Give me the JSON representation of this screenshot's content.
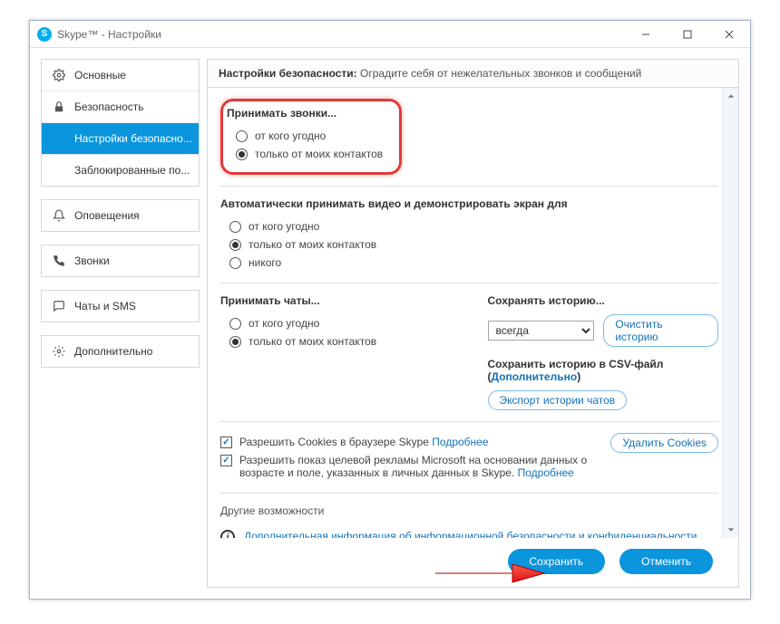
{
  "window": {
    "title": "Skype™ - Настройки"
  },
  "sidebar": {
    "general": "Основные",
    "security": "Безопасность",
    "security_settings": "Настройки безопасно...",
    "blocked": "Заблокированные по...",
    "notifications": "Оповещения",
    "calls": "Звонки",
    "chats_sms": "Чаты и SMS",
    "advanced": "Дополнительно"
  },
  "header": {
    "title": "Настройки безопасности:",
    "subtitle": "Оградите себя от нежелательных звонков и сообщений"
  },
  "calls_allow": {
    "title": "Принимать звонки...",
    "anyone": "от кого угодно",
    "contacts": "только от моих контактов"
  },
  "video_allow": {
    "title": "Автоматически принимать видео и демонстрировать экран для",
    "anyone": "от кого угодно",
    "contacts": "только от моих контактов",
    "nobody": "никого"
  },
  "chats_allow": {
    "title": "Принимать чаты...",
    "anyone": "от кого угодно",
    "contacts": "только от моих контактов"
  },
  "history": {
    "title": "Сохранять историю...",
    "value": "всегда",
    "clear_btn": "Очистить историю",
    "csv_label": "Сохранить историю в CSV-файл (",
    "csv_link": "Дополнительно",
    "csv_close": ")",
    "export_btn": "Экспорт истории чатов"
  },
  "cookies": {
    "allow_label": "Разрешить Cookies в браузере Skype ",
    "details": "Подробнее",
    "delete_btn": "Удалить Cookies"
  },
  "ads": {
    "label_part1": "Разрешить показ целевой рекламы Microsoft на основании данных о возрасте и поле, указанных в личных данных в Skype. ",
    "details": "Подробнее"
  },
  "other": {
    "title": "Другие возможности",
    "info_link": "Дополнительная информация об информационной безопасности и конфиденциальности данных в Skype"
  },
  "footer": {
    "save": "Сохранить",
    "cancel": "Отменить"
  }
}
